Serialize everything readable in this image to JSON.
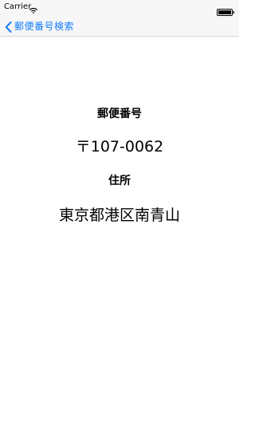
{
  "status_bar": {
    "carrier": "Carrier",
    "wifi_icon": "wifi-icon",
    "battery_icon": "battery-icon"
  },
  "nav": {
    "back_label": "郵便番号検索",
    "back_icon": "chevron-left-icon",
    "accent_color": "#157efb"
  },
  "result": {
    "postal_label": "郵便番号",
    "postal_value": "〒107-0062",
    "address_label": "住所",
    "address_value": "東京都港区南青山"
  }
}
